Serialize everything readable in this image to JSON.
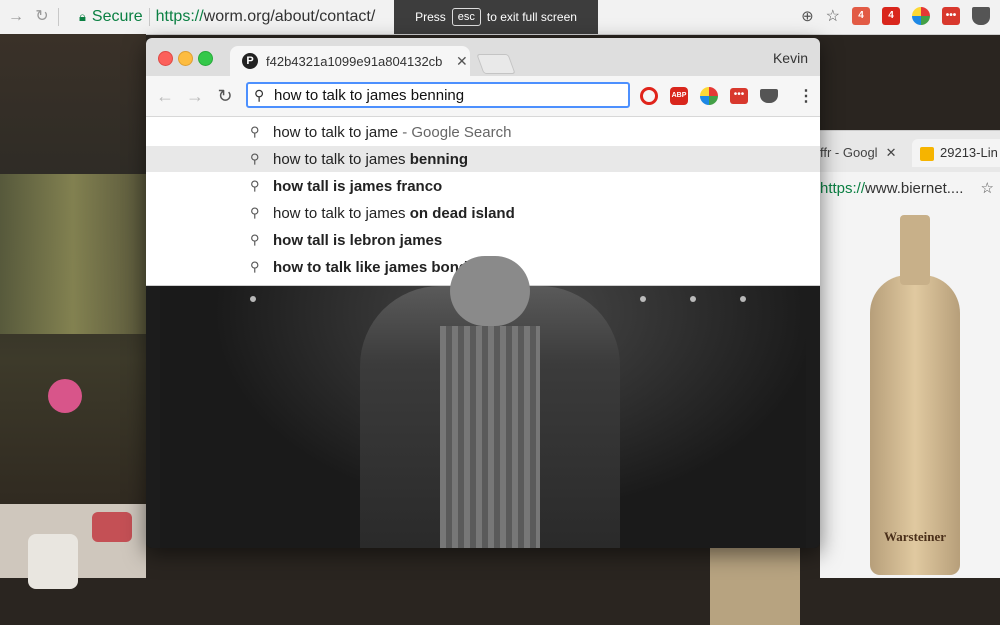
{
  "background_browser": {
    "secure_label": "Secure",
    "url_scheme": "https://",
    "url_rest": "worm.org/about/contact/",
    "fullscreen_banner": {
      "press": "Press",
      "key": "esc",
      "rest": "to exit full screen"
    },
    "ext_badges": [
      "4",
      "4"
    ]
  },
  "right_browser": {
    "tab1_title": "ffr - Googl",
    "tab2_title": "29213-Lin",
    "url_scheme": "https://",
    "url_rest": "www.biernet...."
  },
  "bottle": {
    "brand": "Warsteiner"
  },
  "window": {
    "tab_title": "f42b4321a1099e91a804132cb",
    "user": "Kevin",
    "omnibox_value": "how to talk to james benning",
    "extensions": [
      "opera",
      "adblock-plus",
      "pinwheel",
      "dots",
      "pocket"
    ],
    "abp_label": "ABP"
  },
  "suggestions": [
    {
      "prefix": "how to talk to jame",
      "bold": "",
      "suffix": " - Google Search",
      "selected": false
    },
    {
      "prefix": "how to talk to james",
      "bold": " benning",
      "suffix": "",
      "selected": true
    },
    {
      "prefix": "",
      "bold": "how tall is james franco",
      "suffix": "",
      "selected": false
    },
    {
      "prefix": "how to talk to james",
      "bold": " on dead island",
      "suffix": "",
      "selected": false
    },
    {
      "prefix": "",
      "bold": "how tall is lebron james",
      "suffix": "",
      "selected": false
    },
    {
      "prefix": "",
      "bold": "how to talk like james bond",
      "suffix": "",
      "selected": false
    }
  ]
}
